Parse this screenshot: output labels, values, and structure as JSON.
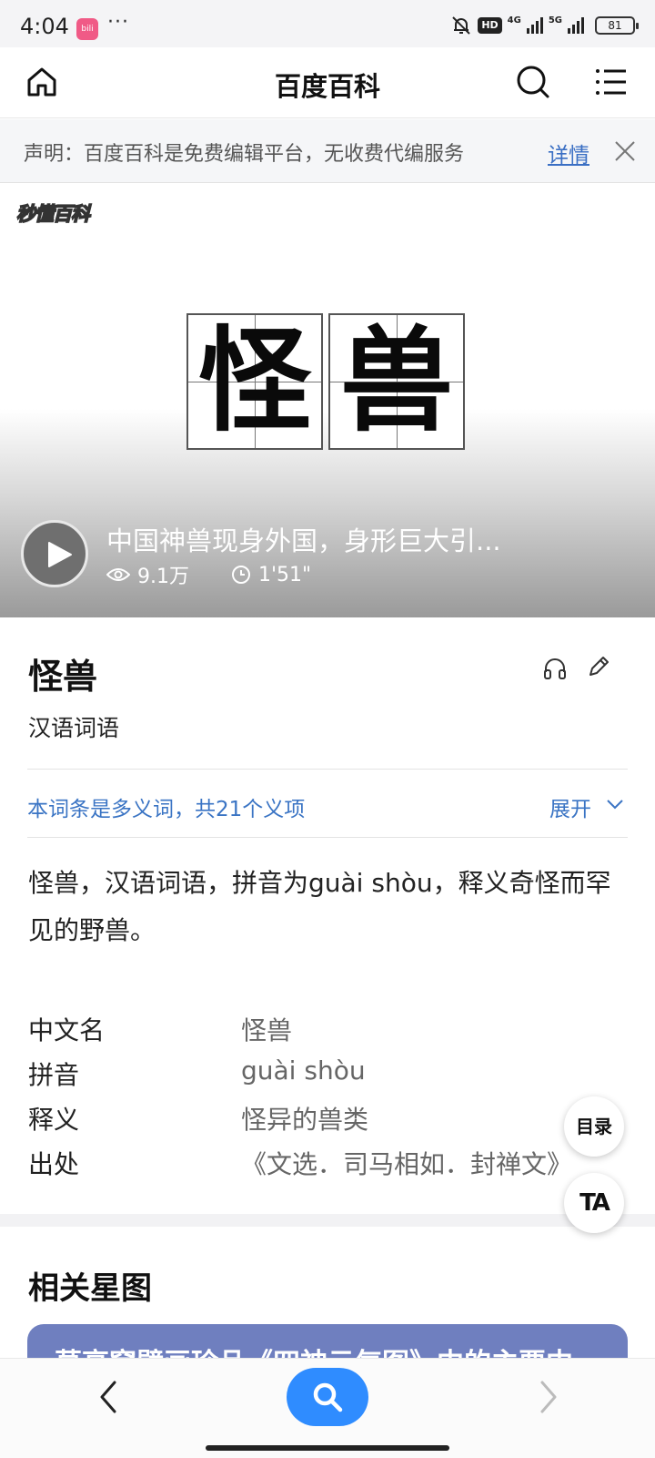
{
  "status_bar": {
    "time": "4:04",
    "app_badge": "bilibili",
    "more": "···",
    "hd": "HD",
    "net1": "4G",
    "net2": "5G",
    "battery": "81"
  },
  "header": {
    "title": "百度百科",
    "icons": [
      "home-icon",
      "search-icon",
      "menu-icon"
    ]
  },
  "notice": {
    "text": "声明：百度百科是免费编辑平台，无收费代编服务",
    "link": "详情"
  },
  "hero": {
    "logo": "秒懂百科",
    "glyph_1": "怪",
    "glyph_2": "兽",
    "video_title": "中国神兽现身外国，身形巨大引...",
    "views": "9.1万",
    "duration": "1'51\""
  },
  "entry": {
    "title": "怪兽",
    "subtitle": "汉语词语",
    "polysemy_text": "本词条是多义词，共21个义项",
    "expand_label": "展开",
    "summary": "怪兽，汉语词语，拼音为guài shòu，释义奇怪而罕见的野兽。"
  },
  "info": [
    {
      "key": "中文名",
      "value": "怪兽"
    },
    {
      "key": "拼音",
      "value": "guài shòu"
    },
    {
      "key": "释义",
      "value": "怪异的兽类"
    },
    {
      "key": "出处",
      "value": "《文选．司马相如．封禅文》"
    }
  ],
  "fab": {
    "toc": "目录",
    "text_size": "TA"
  },
  "related": {
    "title": "相关星图",
    "card_text": "莫高窟壁画珍品《四神云气图》中的主要中"
  },
  "colors": {
    "link_blue": "#3a74c4",
    "search_button": "#2f8cff",
    "card_bg": "#6f7fbf"
  }
}
